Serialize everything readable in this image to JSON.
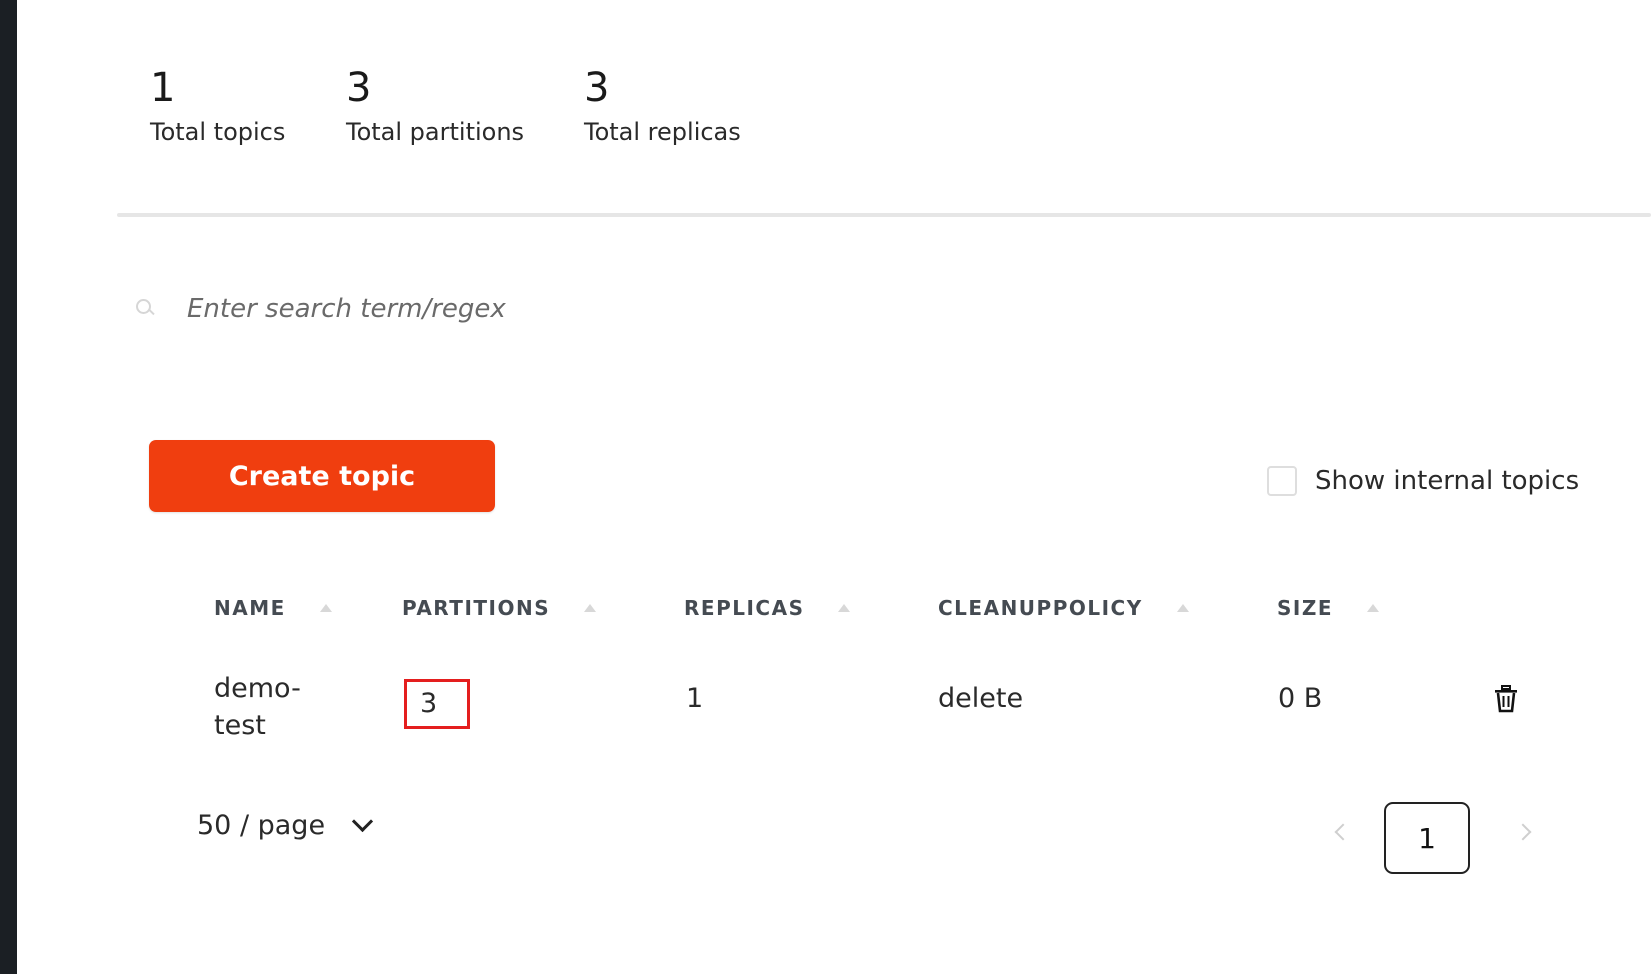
{
  "stats": {
    "topics": {
      "value": "1",
      "label": "Total topics"
    },
    "partitions": {
      "value": "3",
      "label": "Total partitions"
    },
    "replicas": {
      "value": "3",
      "label": "Total replicas"
    }
  },
  "search": {
    "placeholder": "Enter search term/regex",
    "icon": "search-icon"
  },
  "create_button": {
    "label": "Create topic",
    "color": "#f03e0f"
  },
  "show_internal": {
    "label": "Show internal topics",
    "checked": false
  },
  "table": {
    "columns": [
      "NAME",
      "PARTITIONS",
      "REPLICAS",
      "CLEANUPPOLICY",
      "SIZE"
    ],
    "rows": [
      {
        "name": "demo-test",
        "partitions": "3",
        "replicas": "1",
        "cleanup_policy": "delete",
        "size": "0 B",
        "action_icon": "trash-icon"
      }
    ],
    "highlight_color": "#e41e1e"
  },
  "pagination": {
    "page_size": "50 / page",
    "current_page": "1"
  }
}
